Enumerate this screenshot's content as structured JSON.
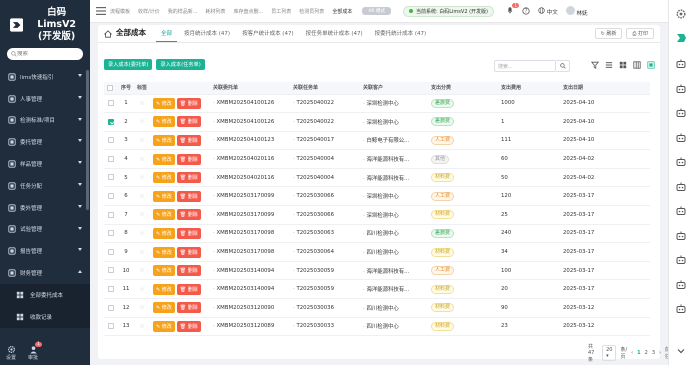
{
  "app": {
    "logo_line1": "白码LimsV2",
    "logo_line2": "(开发版)"
  },
  "sidebar": {
    "search_placeholder": "搜索",
    "items": [
      {
        "label": "lims快速指引",
        "open": false
      },
      {
        "label": "人事管理",
        "open": false
      },
      {
        "label": "检测标准/项目",
        "open": false
      },
      {
        "label": "委托管理",
        "open": false
      },
      {
        "label": "样品管理",
        "open": false
      },
      {
        "label": "任务分配",
        "open": false
      },
      {
        "label": "委外管理",
        "open": false
      },
      {
        "label": "试验管理",
        "open": false
      },
      {
        "label": "报告管理",
        "open": false
      },
      {
        "label": "财务管理",
        "open": true
      }
    ],
    "sub_items": [
      {
        "label": "全部委托成本"
      },
      {
        "label": "收款记录"
      }
    ],
    "bottom": {
      "settings_label": "设置",
      "audit_label": "审批",
      "audit_badge": "1"
    }
  },
  "topbar": {
    "nav": [
      "流程模板",
      "收样/计价",
      "我的样品新...",
      "耗材列表",
      "库存盘点删...",
      "员工列表",
      "检测员列表",
      "全部成本"
    ],
    "mode_label": "AR 模式",
    "system_label": "当前系统: 白码LimsV2 (开发版)",
    "bell_badge": "1",
    "lang_label": "中文",
    "user_name": "林妩"
  },
  "page": {
    "title": "全部成本",
    "tabs": [
      {
        "label": "全部",
        "active": true
      },
      {
        "label": "按月统计成本 (47)",
        "active": false
      },
      {
        "label": "按客户统计成本 (47)",
        "active": false
      },
      {
        "label": "按任务单统计成本 (47)",
        "active": false
      },
      {
        "label": "按委托统计成本 (47)",
        "active": false
      }
    ],
    "refresh_label": "刷新",
    "print_label": "打印",
    "action_buttons": [
      "录入成本(委托单)",
      "录入成本(任务单)"
    ],
    "search_placeholder": "搜索..."
  },
  "table": {
    "headers": [
      "序号",
      "标签",
      "",
      "关联委托单",
      "关联任务单",
      "关联客户",
      "支出分类",
      "支出费用",
      "支出日期"
    ],
    "edit_label": "修改",
    "delete_label": "删除",
    "rows": [
      {
        "no": "1",
        "checked": false,
        "entrust": "XMBM202504100126",
        "task": "T2025040022",
        "client": "深圳检测中心",
        "category": "差旅费",
        "cat_color": "g",
        "amount": "1000",
        "date": "2025-04-10"
      },
      {
        "no": "2",
        "checked": true,
        "entrust": "XMBM202504100126",
        "task": "T2025040022",
        "client": "深圳检测中心",
        "category": "差旅费",
        "cat_color": "g",
        "amount": "1",
        "date": "2025-04-10"
      },
      {
        "no": "3",
        "checked": false,
        "entrust": "XMBM202504100123",
        "task": "T2025040017",
        "client": "白鲸电子有限公...",
        "category": "人工费",
        "cat_color": "o",
        "amount": "111",
        "date": "2025-04-10"
      },
      {
        "no": "4",
        "checked": false,
        "entrust": "XMBM202504020116",
        "task": "T2025040004",
        "client": "海洋能源科技有...",
        "category": "其他",
        "cat_color": "gray",
        "amount": "60",
        "date": "2025-04-02"
      },
      {
        "no": "5",
        "checked": false,
        "entrust": "XMBM202504020116",
        "task": "T2025040004",
        "client": "海洋能源科技有...",
        "category": "材料费",
        "cat_color": "y",
        "amount": "50",
        "date": "2025-04-02"
      },
      {
        "no": "6",
        "checked": false,
        "entrust": "XMBM202503170099",
        "task": "T2025030066",
        "client": "深圳检测中心",
        "category": "人工费",
        "cat_color": "o",
        "amount": "120",
        "date": "2025-03-17"
      },
      {
        "no": "7",
        "checked": false,
        "entrust": "XMBM202503170099",
        "task": "T2025030066",
        "client": "深圳检测中心",
        "category": "材料费",
        "cat_color": "y",
        "amount": "25",
        "date": "2025-03-17"
      },
      {
        "no": "8",
        "checked": false,
        "entrust": "XMBM202503170098",
        "task": "T2025030063",
        "client": "四川检测中心",
        "category": "差旅费",
        "cat_color": "g",
        "amount": "240",
        "date": "2025-03-17"
      },
      {
        "no": "9",
        "checked": false,
        "entrust": "XMBM202503170098",
        "task": "T2025030064",
        "client": "四川检测中心",
        "category": "材料费",
        "cat_color": "y",
        "amount": "34",
        "date": "2025-03-17"
      },
      {
        "no": "10",
        "checked": false,
        "entrust": "XMBM202503140094",
        "task": "T2025030059",
        "client": "海洋能源科技有...",
        "category": "人工费",
        "cat_color": "o",
        "amount": "100",
        "date": "2025-03-17"
      },
      {
        "no": "11",
        "checked": false,
        "entrust": "XMBM202503140094",
        "task": "T2025030059",
        "client": "海洋能源科技有...",
        "category": "材料费",
        "cat_color": "y",
        "amount": "20",
        "date": "2025-03-17"
      },
      {
        "no": "12",
        "checked": false,
        "entrust": "XMBM202503120090",
        "task": "T2025030036",
        "client": "四川检测中心",
        "category": "材料费",
        "cat_color": "y",
        "amount": "90",
        "date": "2025-03-12"
      },
      {
        "no": "13",
        "checked": false,
        "entrust": "XMBM202503120089",
        "task": "T2025030033",
        "client": "四川检测中心",
        "category": "材料费",
        "cat_color": "y",
        "amount": "23",
        "date": "2025-03-12"
      }
    ]
  },
  "pagination": {
    "total_label": "共 47 条",
    "page_size": "20",
    "per_page_label": "条/页",
    "pages": [
      "1",
      "2",
      "3"
    ],
    "current": "1",
    "goto_label": "前往",
    "goto_value": "1",
    "page_unit": "页"
  },
  "colors": {
    "accent": "#1ab394",
    "sidebar_bg": "#1f2d3d",
    "edit": "#f7a21b",
    "delete": "#f45a4a"
  }
}
